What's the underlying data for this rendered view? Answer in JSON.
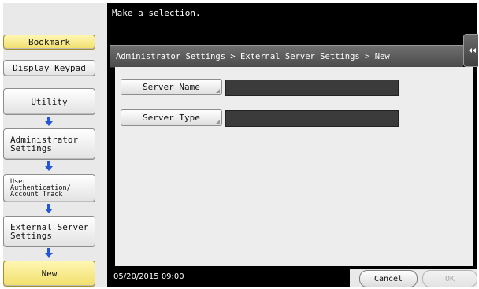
{
  "header": {
    "message": "Make a selection."
  },
  "sidebar": {
    "bookmark": "Bookmark",
    "display_keypad": "Display Keypad",
    "steps": [
      {
        "label": "Utility"
      },
      {
        "label": "Administrator\nSettings"
      },
      {
        "label": "User\nAuthentication/\nAccount Track"
      },
      {
        "label": "External Server\nSettings"
      },
      {
        "label": "New"
      }
    ]
  },
  "main": {
    "breadcrumb": "Administrator Settings > External Server Settings > New",
    "fields": [
      {
        "label": "Server Name",
        "value": ""
      },
      {
        "label": "Server Type",
        "value": ""
      }
    ]
  },
  "footer": {
    "datetime": "05/20/2015  09:00",
    "cancel": "Cancel",
    "ok": "OK"
  },
  "colors": {
    "accent_blue": "#2456d8",
    "highlight_yellow": "#f1df6b",
    "field_dark": "#3b3b3b"
  }
}
